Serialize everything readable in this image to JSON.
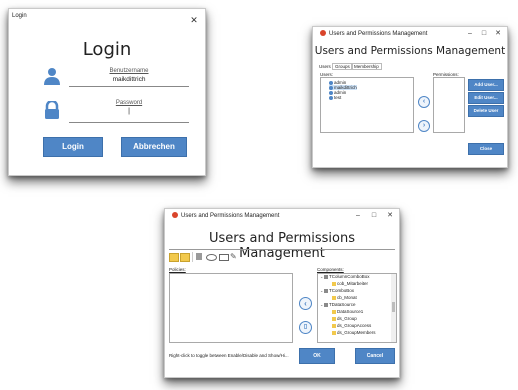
{
  "login": {
    "title": "Login",
    "close": "✕",
    "heading": "Login",
    "username_label": "Benutzername",
    "username_value": "maikdittrich",
    "password_label": "Password",
    "password_value": "|",
    "login_button": "Login",
    "cancel_button": "Abbrechen",
    "accent": "#4f86c6"
  },
  "users_window": {
    "title": "Users and Permissions Management",
    "heading": "Users and Permissions Management",
    "tabs": [
      "Users",
      "Groups",
      "Membership"
    ],
    "users_label": "Users:",
    "permissions_label": "Permissions:",
    "users": [
      "admin",
      "maikdittrich",
      "admin",
      "test"
    ],
    "add_user": "Add User...",
    "edit_user": "Edit User...",
    "delete_user": "Delete User",
    "close_button": "Close"
  },
  "policy_window": {
    "title": "Users and Permissions Management",
    "heading": "Users and Permissions Management",
    "policies_label": "Policies:",
    "components_label": "Components:",
    "components": [
      {
        "level": 0,
        "exp": "⌄",
        "label": "TColumnComboBox"
      },
      {
        "level": 1,
        "exp": "",
        "label": "cob_Mitarbeiter"
      },
      {
        "level": 0,
        "exp": "⌄",
        "label": "TComboBox"
      },
      {
        "level": 1,
        "exp": "",
        "label": "cb_Monat"
      },
      {
        "level": 0,
        "exp": "⌄",
        "label": "TDataSource"
      },
      {
        "level": 1,
        "exp": "",
        "label": "DataSource1"
      },
      {
        "level": 1,
        "exp": "",
        "label": "ds_Group"
      },
      {
        "level": 1,
        "exp": "",
        "label": "ds_GroupAccess"
      },
      {
        "level": 1,
        "exp": "",
        "label": "ds_GroupMembers"
      }
    ],
    "hint": "Right-click to toggle between Enable/Disable and Show/Hi...",
    "ok_button": "OK",
    "cancel_button": "Cancel"
  }
}
